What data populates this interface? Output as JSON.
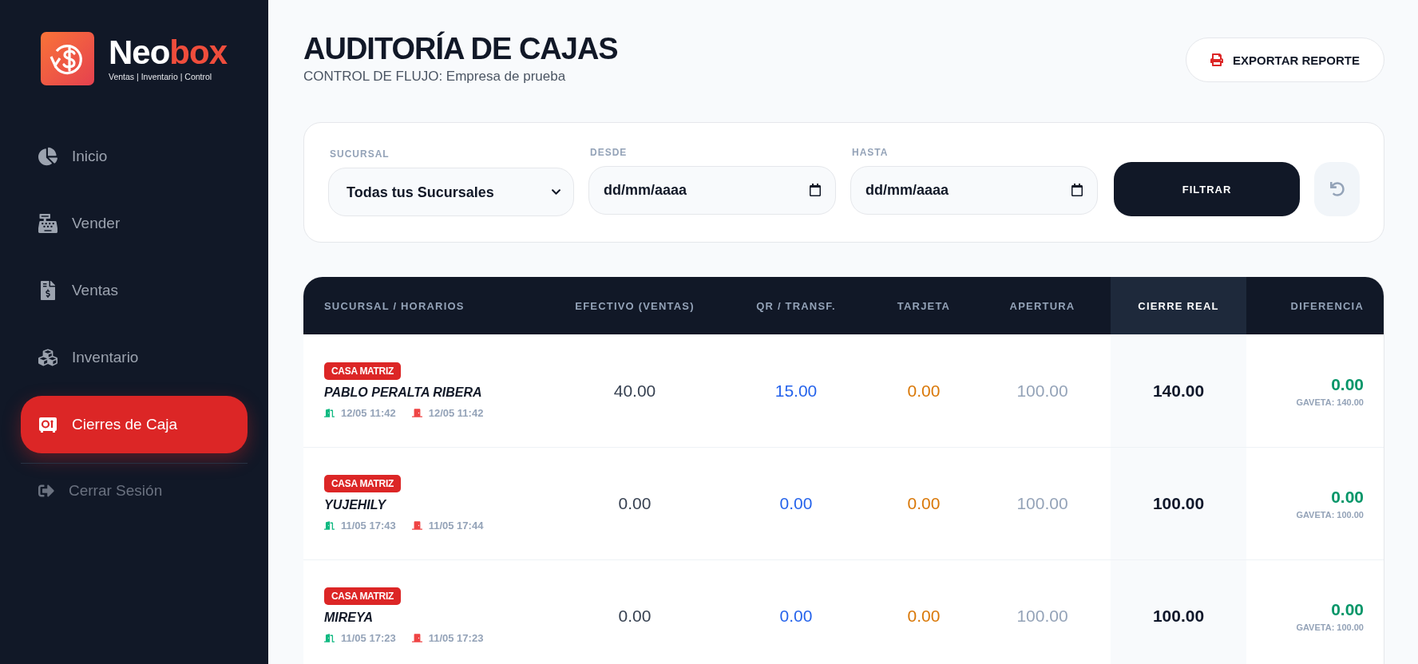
{
  "brand": {
    "name_start": "Neo",
    "name_end": "box",
    "tagline": "Ventas | Inventario | Control"
  },
  "sidebar": {
    "items": [
      {
        "kind": "home",
        "label": "Inicio",
        "selected": false
      },
      {
        "kind": "sell",
        "label": "Vender",
        "selected": false
      },
      {
        "kind": "sales",
        "label": "Ventas",
        "selected": false
      },
      {
        "kind": "inventory",
        "label": "Inventario",
        "selected": false
      },
      {
        "kind": "closings",
        "label": "Cierres de Caja",
        "selected": true
      }
    ],
    "logout": {
      "label": "Cerrar Sesión"
    }
  },
  "header": {
    "title": "AUDITORÍA DE CAJAS",
    "subtitle": "CONTROL DE FLUJO: Empresa de prueba",
    "export_button": "EXPORTAR REPORTE"
  },
  "filters": {
    "branch": {
      "label": "SUCURSAL",
      "value": "Todas tus Sucursales"
    },
    "from": {
      "label": "DESDE",
      "placeholder": "dd/mm/aaaa"
    },
    "to": {
      "label": "HASTA",
      "placeholder": "dd/mm/aaaa"
    },
    "filter_button": "FILTRAR"
  },
  "table": {
    "columns": [
      {
        "label": "SUCURSAL / HORARIOS",
        "highlighted": false
      },
      {
        "label": "EFECTIVO (VENTAS)",
        "highlighted": false
      },
      {
        "label": "QR / TRANSF.",
        "highlighted": false
      },
      {
        "label": "TARJETA",
        "highlighted": false
      },
      {
        "label": "APERTURA",
        "highlighted": false
      },
      {
        "label": "CIERRE REAL",
        "highlighted": true
      },
      {
        "label": "DIFERENCIA",
        "highlighted": false
      }
    ],
    "rows": [
      {
        "branch": "CASA MATRIZ",
        "user": "PABLO PERALTA RIBERA",
        "opened": "12/05 11:42",
        "closed": "12/05 11:42",
        "cash": "40.00",
        "qr": "15.00",
        "card": "0.00",
        "opening": "100.00",
        "closing": "140.00",
        "difference": "0.00",
        "drawer": "GAVETA: 140.00"
      },
      {
        "branch": "CASA MATRIZ",
        "user": "YUJEHILY",
        "opened": "11/05 17:43",
        "closed": "11/05 17:44",
        "cash": "0.00",
        "qr": "0.00",
        "card": "0.00",
        "opening": "100.00",
        "closing": "100.00",
        "difference": "0.00",
        "drawer": "GAVETA: 100.00"
      },
      {
        "branch": "CASA MATRIZ",
        "user": "MIREYA",
        "opened": "11/05 17:23",
        "closed": "11/05 17:23",
        "cash": "0.00",
        "qr": "0.00",
        "card": "0.00",
        "opening": "100.00",
        "closing": "100.00",
        "difference": "0.00",
        "drawer": "GAVETA: 100.00"
      }
    ]
  }
}
